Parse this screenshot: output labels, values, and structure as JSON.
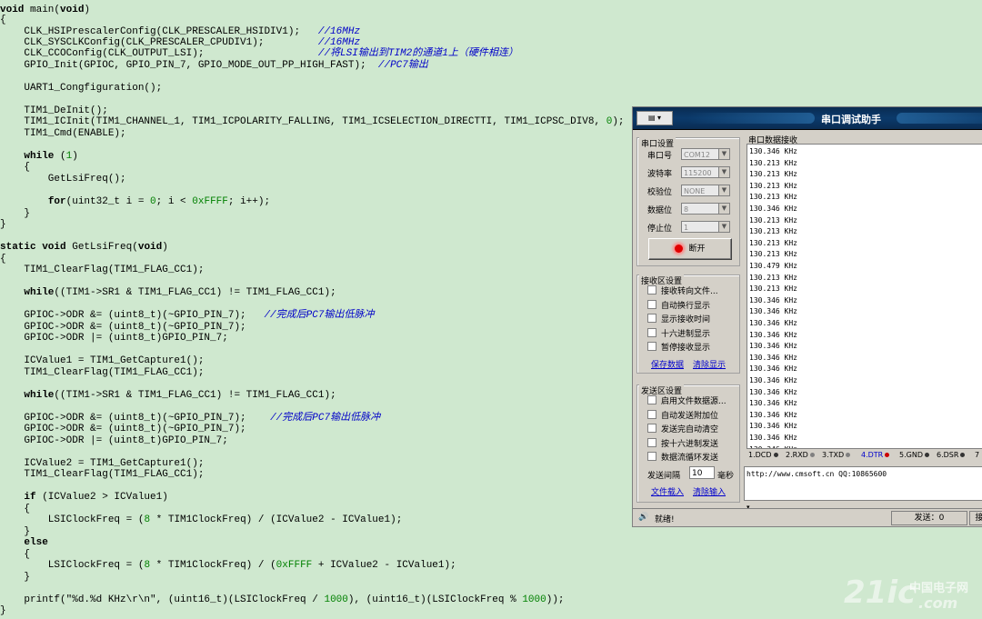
{
  "code": {
    "lines": [
      [
        {
          "t": "void",
          "c": "kw"
        },
        {
          "t": " main("
        },
        {
          "t": "void",
          "c": "kw"
        },
        {
          "t": ")"
        }
      ],
      [
        {
          "t": "{"
        }
      ],
      [
        {
          "t": "    CLK_HSIPrescalerConfig(CLK_PRESCALER_HSIDIV1);   "
        },
        {
          "t": "//16MHz",
          "c": "cm"
        }
      ],
      [
        {
          "t": "    CLK_SYSCLKConfig(CLK_PRESCALER_CPUDIV1);         "
        },
        {
          "t": "//16MHz",
          "c": "cm"
        }
      ],
      [
        {
          "t": "    CLK_CCOConfig(CLK_OUTPUT_LSI);                   "
        },
        {
          "t": "//将LSI输出到TIM2的通道1上（硬件相连）",
          "c": "cm"
        }
      ],
      [
        {
          "t": "    GPIO_Init(GPIOC, GPIO_PIN_7, GPIO_MODE_OUT_PP_HIGH_FAST);  "
        },
        {
          "t": "//PC7输出",
          "c": "cm"
        }
      ],
      [],
      [
        {
          "t": "    UART1_Congfiguration();"
        }
      ],
      [],
      [
        {
          "t": "    TIM1_DeInit();"
        }
      ],
      [
        {
          "t": "    TIM1_ICInit(TIM1_CHANNEL_1, TIM1_ICPOLARITY_FALLING, TIM1_ICSELECTION_DIRECTTI, TIM1_ICPSC_DIV8, "
        },
        {
          "t": "0",
          "c": "num"
        },
        {
          "t": ");"
        }
      ],
      [
        {
          "t": "    TIM1_Cmd(ENABLE);"
        }
      ],
      [],
      [
        {
          "t": "    "
        },
        {
          "t": "while",
          "c": "kw"
        },
        {
          "t": " ("
        },
        {
          "t": "1",
          "c": "num"
        },
        {
          "t": ")"
        }
      ],
      [
        {
          "t": "    {"
        }
      ],
      [
        {
          "t": "        GetLsiFreq();"
        }
      ],
      [],
      [
        {
          "t": "        "
        },
        {
          "t": "for",
          "c": "kw"
        },
        {
          "t": "(uint32_t i = "
        },
        {
          "t": "0",
          "c": "num"
        },
        {
          "t": "; i < "
        },
        {
          "t": "0xFFFF",
          "c": "num"
        },
        {
          "t": "; i++);"
        }
      ],
      [
        {
          "t": "    }"
        }
      ],
      [
        {
          "t": "}"
        }
      ],
      [],
      [
        {
          "t": "static void",
          "c": "kw"
        },
        {
          "t": " GetLsiFreq("
        },
        {
          "t": "void",
          "c": "kw"
        },
        {
          "t": ")"
        }
      ],
      [
        {
          "t": "{"
        }
      ],
      [
        {
          "t": "    TIM1_ClearFlag(TIM1_FLAG_CC1);"
        }
      ],
      [],
      [
        {
          "t": "    "
        },
        {
          "t": "while",
          "c": "kw"
        },
        {
          "t": "((TIM1->SR1 & TIM1_FLAG_CC1) != TIM1_FLAG_CC1);"
        }
      ],
      [],
      [
        {
          "t": "    GPIOC->ODR &= (uint8_t)(~GPIO_PIN_7);   "
        },
        {
          "t": "//完成后PC7输出低脉冲",
          "c": "cm"
        }
      ],
      [
        {
          "t": "    GPIOC->ODR &= (uint8_t)(~GPIO_PIN_7);"
        }
      ],
      [
        {
          "t": "    GPIOC->ODR |= (uint8_t)GPIO_PIN_7;"
        }
      ],
      [],
      [
        {
          "t": "    ICValue1 = TIM1_GetCapture1();"
        }
      ],
      [
        {
          "t": "    TIM1_ClearFlag(TIM1_FLAG_CC1);"
        }
      ],
      [],
      [
        {
          "t": "    "
        },
        {
          "t": "while",
          "c": "kw"
        },
        {
          "t": "((TIM1->SR1 & TIM1_FLAG_CC1) != TIM1_FLAG_CC1);"
        }
      ],
      [],
      [
        {
          "t": "    GPIOC->ODR &= (uint8_t)(~GPIO_PIN_7);    "
        },
        {
          "t": "//完成后PC7输出低脉冲",
          "c": "cm"
        }
      ],
      [
        {
          "t": "    GPIOC->ODR &= (uint8_t)(~GPIO_PIN_7);"
        }
      ],
      [
        {
          "t": "    GPIOC->ODR |= (uint8_t)GPIO_PIN_7;"
        }
      ],
      [],
      [
        {
          "t": "    ICValue2 = TIM1_GetCapture1();"
        }
      ],
      [
        {
          "t": "    TIM1_ClearFlag(TIM1_FLAG_CC1);"
        }
      ],
      [],
      [
        {
          "t": "    "
        },
        {
          "t": "if",
          "c": "kw"
        },
        {
          "t": " (ICValue2 > ICValue1)"
        }
      ],
      [
        {
          "t": "    {"
        }
      ],
      [
        {
          "t": "        LSIClockFreq = ("
        },
        {
          "t": "8",
          "c": "num"
        },
        {
          "t": " * TIM1ClockFreq) / (ICValue2 - ICValue1);"
        }
      ],
      [
        {
          "t": "    }"
        }
      ],
      [
        {
          "t": "    "
        },
        {
          "t": "else",
          "c": "kw"
        }
      ],
      [
        {
          "t": "    {"
        }
      ],
      [
        {
          "t": "        LSIClockFreq = ("
        },
        {
          "t": "8",
          "c": "num"
        },
        {
          "t": " * TIM1ClockFreq) / ("
        },
        {
          "t": "0xFFFF",
          "c": "num"
        },
        {
          "t": " + ICValue2 - ICValue1);"
        }
      ],
      [
        {
          "t": "    }"
        }
      ],
      [],
      [
        {
          "t": "    printf(\"%d.%d KHz\\r\\n\", (uint16_t)(LSIClockFreq / "
        },
        {
          "t": "1000",
          "c": "num"
        },
        {
          "t": "), (uint16_t)(LSIClockFreq % "
        },
        {
          "t": "1000",
          "c": "num"
        },
        {
          "t": "));"
        }
      ],
      [
        {
          "t": "}"
        }
      ]
    ]
  },
  "terminal": {
    "title": "串口调试助手",
    "serial_settings": {
      "group_title": "串口设置",
      "fields": [
        {
          "label": "串口号",
          "value": "COM12"
        },
        {
          "label": "波特率",
          "value": "115200"
        },
        {
          "label": "校验位",
          "value": "NONE"
        },
        {
          "label": "数据位",
          "value": "8"
        },
        {
          "label": "停止位",
          "value": "1"
        }
      ],
      "disconnect_label": "断开"
    },
    "receive_settings": {
      "group_title": "接收区设置",
      "options": [
        "接收转向文件...",
        "自动换行显示",
        "显示接收时间",
        "十六进制显示",
        "暂停接收显示"
      ],
      "save_link": "保存数据",
      "clear_link": "清除显示"
    },
    "send_settings": {
      "group_title": "发送区设置",
      "options": [
        "启用文件数据源...",
        "自动发送附加位",
        "发送完自动清空",
        "按十六进制发送",
        "数据流循环发送"
      ],
      "interval_label": "发送间隔",
      "interval_value": "10",
      "interval_unit": "毫秒",
      "load_link": "文件载入",
      "clear_link": "清除输入"
    },
    "receive_area": {
      "title": "串口数据接收",
      "lines": [
        "130.346 KHz",
        "130.213 KHz",
        "130.213 KHz",
        "130.213 KHz",
        "130.213 KHz",
        "130.346 KHz",
        "130.213 KHz",
        "130.213 KHz",
        "130.213 KHz",
        "130.213 KHz",
        "130.479 KHz",
        "130.213 KHz",
        "130.213 KHz",
        "130.346 KHz",
        "130.346 KHz",
        "130.346 KHz",
        "130.346 KHz",
        "130.346 KHz",
        "130.346 KHz",
        "130.346 KHz",
        "130.346 KHz",
        "130.346 KHz",
        "130.346 KHz",
        "130.346 KHz",
        "130.346 KHz",
        "130.346 KHz",
        "130.346 KHz",
        "130.346 KHz"
      ]
    },
    "pins": [
      {
        "label": "1.DCD",
        "color": "#333333"
      },
      {
        "label": "2.RXD",
        "color": "#808080"
      },
      {
        "label": "3.TXD",
        "color": "#808080"
      },
      {
        "label": "4.DTR",
        "color": "#cc0000"
      },
      {
        "label": "5.GND",
        "color": "#333333"
      },
      {
        "label": "6.DSR",
        "color": "#333333"
      },
      {
        "label": "7",
        "color": "#333333"
      }
    ],
    "send_text": "http://www.cmsoft.cn QQ:10865600",
    "status": "就绪!",
    "send_count": "发送：0",
    "send_button_partial": "接",
    "menu_label": "▾"
  },
  "watermark": {
    "brand": "21ic",
    "cn": "中国电子网",
    "domain": ".com"
  }
}
